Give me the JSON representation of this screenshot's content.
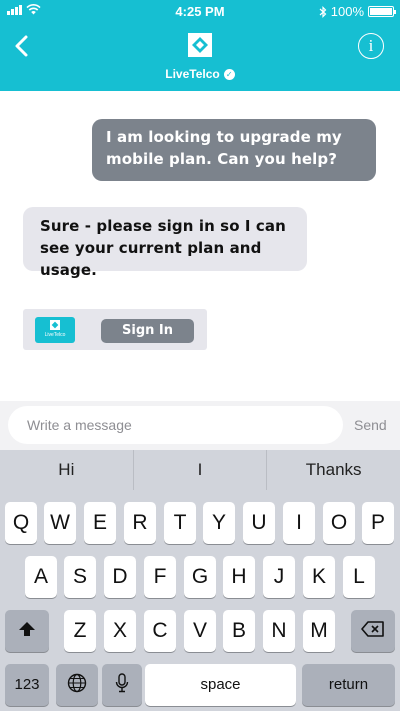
{
  "status_bar": {
    "time": "4:25 PM",
    "battery": "100%",
    "battery_level": 1.0
  },
  "header": {
    "brand_name": "LiveTelco",
    "accent_color": "#16bfd2",
    "back_icon": "chevron-left-icon",
    "info_icon": "info-icon"
  },
  "chat": {
    "outgoing_message": "I am looking to upgrade my mobile plan. Can you help?",
    "incoming_message": "Sure - please sign in so I can see your current plan and usage.",
    "signin_card": {
      "logo_label": "LiveTelco",
      "button_label": "Sign In"
    }
  },
  "composer": {
    "placeholder": "Write a message",
    "send_label": "Send"
  },
  "keyboard": {
    "suggestions": [
      "Hi",
      "I",
      "Thanks"
    ],
    "row1": [
      "Q",
      "W",
      "E",
      "R",
      "T",
      "Y",
      "U",
      "I",
      "O",
      "P"
    ],
    "row2": [
      "A",
      "S",
      "D",
      "F",
      "G",
      "H",
      "J",
      "K",
      "L"
    ],
    "row3": [
      "Z",
      "X",
      "C",
      "V",
      "B",
      "N",
      "M"
    ],
    "numbers_label": "123",
    "space_label": "space",
    "return_label": "return"
  }
}
